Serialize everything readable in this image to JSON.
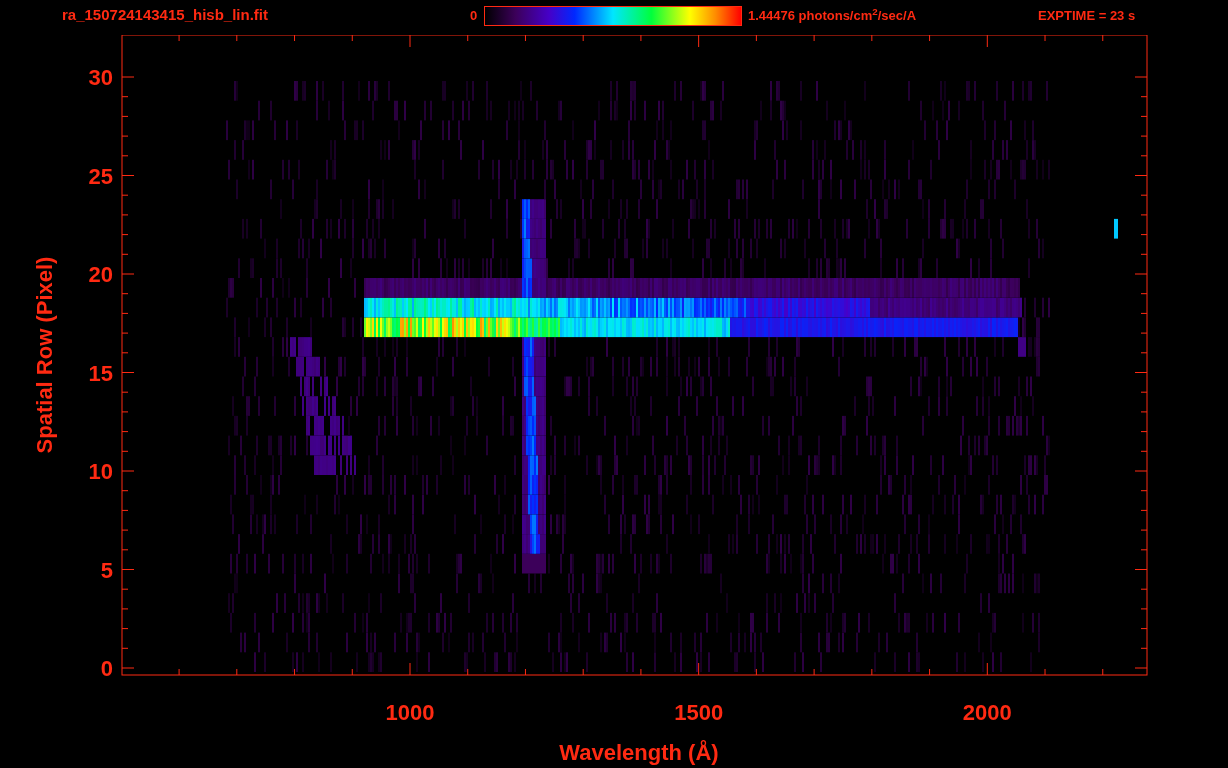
{
  "header": {
    "filename": "ra_150724143415_hisb_lin.fit",
    "colorbar_min": "0",
    "colorbar_max": "1.44476 photons/cm$^{2}$/sec/A",
    "exptime": "EXPTIME = 23 s"
  },
  "plot": {
    "ylabel": "Spatial Row (Pixel)",
    "xlabel": "Wavelength (Å)",
    "yticks": [
      "30",
      "25",
      "20",
      "15",
      "10",
      "5",
      "0"
    ],
    "xticks": [
      "1000",
      "1500",
      "2000"
    ]
  }
}
